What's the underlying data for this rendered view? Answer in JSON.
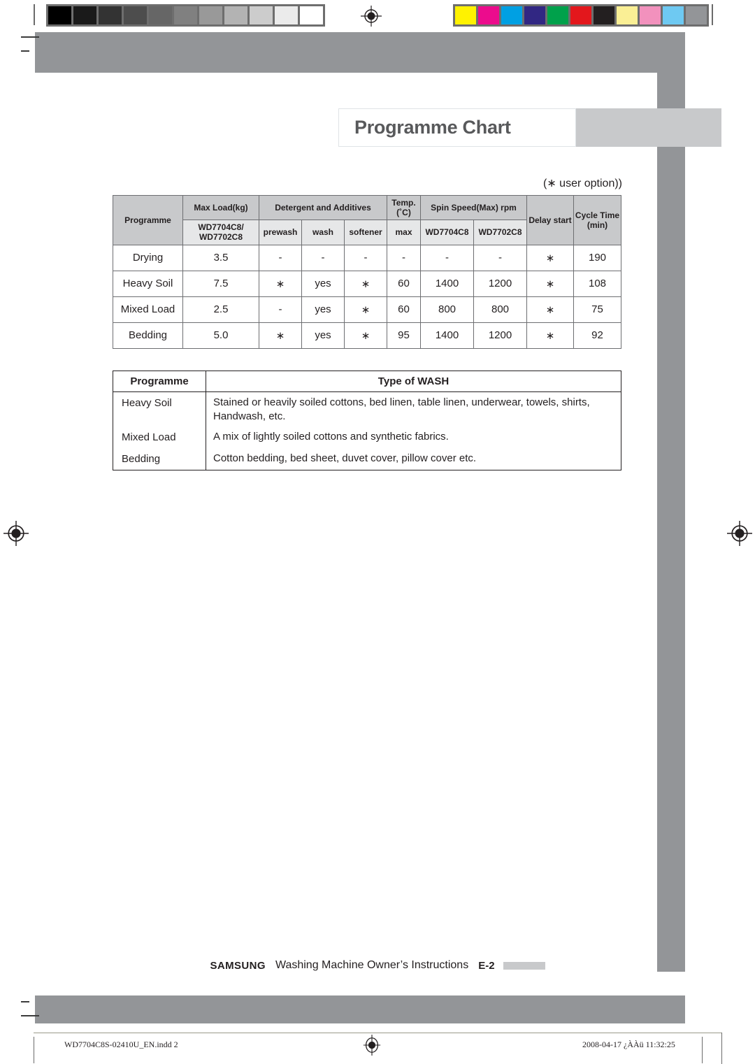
{
  "document": {
    "title": "Programme Chart",
    "user_option_note": "(∗ user option))"
  },
  "calibration": {
    "grayscale_patches": [
      "#000000",
      "#1a1a1a",
      "#333333",
      "#4d4d4d",
      "#666666",
      "#808080",
      "#999999",
      "#b3b3b3",
      "#cccccc",
      "#ebebeb",
      "#ffffff"
    ],
    "color_patches": [
      "#fff200",
      "#ec0c8d",
      "#00a0e3",
      "#312783",
      "#00a14b",
      "#e3171c",
      "#231f20",
      "#faef95",
      "#f291bd",
      "#6ec9f2",
      "#939598"
    ]
  },
  "programme_table": {
    "group_headers": {
      "programme": "Programme",
      "max_load": "Max Load(kg)",
      "detergent": "Detergent and Additives",
      "temp": "Temp.\n(˚C)",
      "temp_line1": "Temp.",
      "temp_line2": "(˚C)",
      "spin_speed": "Spin Speed(Max) rpm",
      "delay_start": "Delay start",
      "cycle_time_line1": "Cycle Time",
      "cycle_time_line2": "(min)"
    },
    "sub_headers": {
      "model_line1": "WD7704C8/",
      "model_line2": "WD7702C8",
      "prewash": "prewash",
      "wash": "wash",
      "softener": "softener",
      "max": "max",
      "spin_model_a": "WD7704C8",
      "spin_model_b": "WD7702C8"
    },
    "rows": [
      {
        "programme": "Drying",
        "max_load": "3.5",
        "prewash": "-",
        "wash": "-",
        "softener": "-",
        "temp_max": "-",
        "spin_wd7704c8": "-",
        "spin_wd7702c8": "-",
        "delay_start": "∗",
        "cycle_time": "190"
      },
      {
        "programme": "Heavy Soil",
        "max_load": "7.5",
        "prewash": "∗",
        "wash": "yes",
        "softener": "∗",
        "temp_max": "60",
        "spin_wd7704c8": "1400",
        "spin_wd7702c8": "1200",
        "delay_start": "∗",
        "cycle_time": "108"
      },
      {
        "programme": "Mixed Load",
        "max_load": "2.5",
        "prewash": "-",
        "wash": "yes",
        "softener": "∗",
        "temp_max": "60",
        "spin_wd7704c8": "800",
        "spin_wd7702c8": "800",
        "delay_start": "∗",
        "cycle_time": "75"
      },
      {
        "programme": "Bedding",
        "max_load": "5.0",
        "prewash": "∗",
        "wash": "yes",
        "softener": "∗",
        "temp_max": "95",
        "spin_wd7704c8": "1400",
        "spin_wd7702c8": "1200",
        "delay_start": "∗",
        "cycle_time": "92"
      }
    ]
  },
  "wash_type_table": {
    "headers": {
      "programme": "Programme",
      "type_of_wash": "Type of WASH"
    },
    "rows": [
      {
        "programme": "Heavy Soil",
        "description": "Stained or heavily soiled cottons, bed linen, table linen, underwear, towels, shirts, Handwash, etc."
      },
      {
        "programme": "Mixed Load",
        "description": "A mix of lightly soiled cottons and synthetic fabrics."
      },
      {
        "programme": "Bedding",
        "description": "Cotton bedding, bed sheet, duvet cover, pillow cover etc."
      }
    ]
  },
  "footer": {
    "brand": "SAMSUNG",
    "manual_title": "Washing Machine Owner’s Instructions",
    "page_number": "E-2"
  },
  "production_strip": {
    "filename": "WD7704C8S-02410U_EN.indd   2",
    "timestamp": "2008-04-17   ¿ÀÀü 11:32:25"
  },
  "colors": {
    "band_gray": "#939598",
    "band_light_gray": "#c8c9cb",
    "header_gray": "#c8c9cb",
    "subheader_gray": "#e6e7e8",
    "title_text": "#58595b",
    "body_text": "#231f20"
  }
}
